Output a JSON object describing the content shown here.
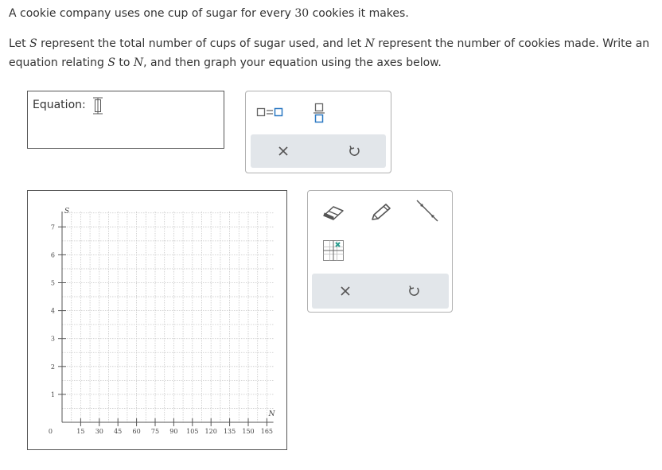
{
  "question": {
    "line1_text": "A cookie company uses one cup of sugar for every ",
    "line1_number": "30",
    "line1_end": " cookies it makes.",
    "line2_a": "Let ",
    "line2_var_s": "S",
    "line2_b": " represent the total number of cups of sugar used, and let ",
    "line2_var_n": "N",
    "line2_c": " represent the number of cookies made. Write an",
    "line3_a": "equation relating ",
    "line3_var_s": "S",
    "line3_b": " to ",
    "line3_var_n": "N",
    "line3_c": ", and then graph your equation using the axes below."
  },
  "equation": {
    "label": "Equation:",
    "value": ""
  },
  "symbol_panel": {
    "icons": [
      "equals-template-icon",
      "fraction-template-icon"
    ],
    "actions": [
      "clear-icon",
      "undo-icon"
    ]
  },
  "graph_tools": {
    "tools": [
      "eraser-icon",
      "pencil-icon",
      "line-tool-icon",
      "point-grid-icon"
    ],
    "actions": [
      "clear-icon",
      "undo-icon"
    ]
  },
  "graph": {
    "x_axis_name": "N",
    "y_axis_name": "S",
    "origin_label": "0",
    "x_tick_labels": [
      "15",
      "30",
      "45",
      "60",
      "75",
      "90",
      "105",
      "120",
      "135",
      "150",
      "165"
    ],
    "y_tick_labels": [
      "1",
      "2",
      "3",
      "4",
      "5",
      "6",
      "7"
    ],
    "colors": {
      "grid": "#c8c8c8",
      "axis": "#555555",
      "accent": "#2a9d8f"
    }
  }
}
